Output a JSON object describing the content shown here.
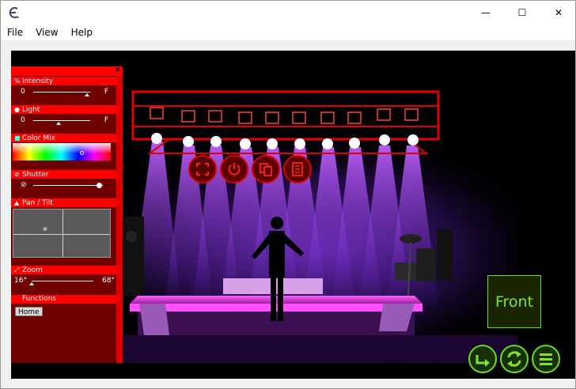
{
  "window": {
    "menu": [
      "File",
      "View",
      "Help"
    ],
    "minimize_glyph": "—",
    "maximize_glyph": "☐",
    "close_glyph": "✕",
    "app_icon": "e-logo-icon"
  },
  "panel": {
    "close_glyph": "×",
    "intensity": {
      "label": "Intensity",
      "icon": "percent-icon",
      "min": "0",
      "max": "F",
      "value_fraction": 0.95
    },
    "light": {
      "label": "Light",
      "icon": "dot-icon",
      "min": "0",
      "max": "F",
      "value_fraction": 0.45
    },
    "color_mix": {
      "label": "Color Mix",
      "icon": "palette-icon"
    },
    "shutter": {
      "label": "Shutter",
      "icon": "shutter-icon",
      "min_glyph": "⊘",
      "value_fraction": 1.0
    },
    "pan_tilt": {
      "label": "Pan / Tilt",
      "icon": "triangle-icon"
    },
    "zoom": {
      "label": "Zoom",
      "icon": "zoom-icon",
      "min": "16°",
      "max": "68°",
      "value_fraction": 0.0
    },
    "functions": {
      "label": "Functions",
      "home": "Home"
    }
  },
  "stage": {
    "front_label": "Front",
    "fixtures_count_shown": 10,
    "controls": [
      "fullscreen-icon",
      "power-icon",
      "copy-icon",
      "list-icon"
    ],
    "nav_buttons": [
      "rotate-arrow-icon",
      "switch-icon",
      "menu-icon"
    ],
    "colors": {
      "accent_red": "#e00000",
      "accent_green": "#6ddc1c",
      "light_purple": "#b040ff",
      "stage_pink": "#ff40ff"
    }
  }
}
